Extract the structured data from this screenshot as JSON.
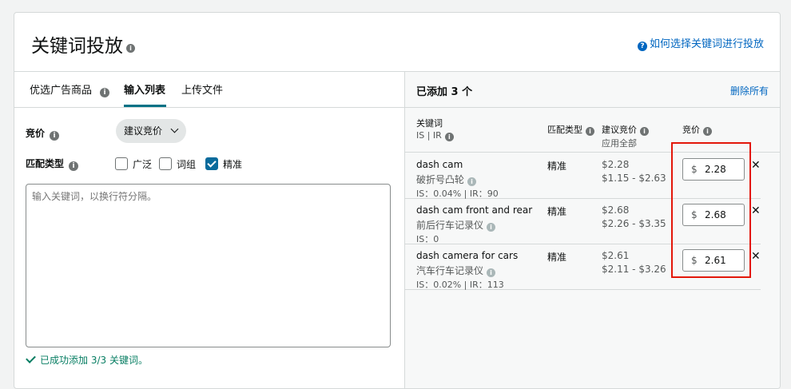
{
  "header": {
    "title": "关键词投放",
    "help_link": "如何选择关键词进行投放"
  },
  "tabs": [
    {
      "label": "优选广告商品",
      "active": false
    },
    {
      "label": "输入列表",
      "active": true
    },
    {
      "label": "上传文件",
      "active": false
    }
  ],
  "form": {
    "bid_label": "竞价",
    "bid_select_value": "建议竞价",
    "match_label": "匹配类型",
    "match_options": [
      {
        "label": "广泛",
        "checked": false
      },
      {
        "label": "词组",
        "checked": false
      },
      {
        "label": "精准",
        "checked": true
      }
    ],
    "textarea_placeholder": "输入关键词，以换行符分隔。",
    "success_text": "已成功添加 3/3 关键词。"
  },
  "added_panel": {
    "title": "已添加 3 个",
    "delete_all": "删除所有",
    "columns": {
      "keyword": "关键词",
      "keyword_sub": "IS | IR",
      "match": "匹配类型",
      "suggested": "建议竞价",
      "apply_all": "应用全部",
      "bid": "竞价"
    },
    "rows": [
      {
        "keyword": "dash cam",
        "translation": "破折号凸轮",
        "metrics": "IS：0.04% | IR：90",
        "match": "精准",
        "suggested": "$2.28",
        "range": "$1.15 - $2.63",
        "currency": "$",
        "bid": "2.28"
      },
      {
        "keyword": "dash cam front and rear",
        "translation": "前后行车记录仪",
        "metrics": "IS：0",
        "match": "精准",
        "suggested": "$2.68",
        "range": "$2.26 - $3.35",
        "currency": "$",
        "bid": "2.68"
      },
      {
        "keyword": "dash camera for cars",
        "translation": "汽车行车记录仪",
        "metrics": "IS：0.02% | IR：113",
        "match": "精准",
        "suggested": "$2.61",
        "range": "$2.11 - $3.26",
        "currency": "$",
        "bid": "2.61"
      }
    ],
    "remove_symbol": "✕"
  },
  "colors": {
    "accent": "#007185",
    "link": "#0066c0",
    "checkbox_checked": "#0a6b9c",
    "success": "#067d62",
    "highlight": "#e3170a"
  }
}
